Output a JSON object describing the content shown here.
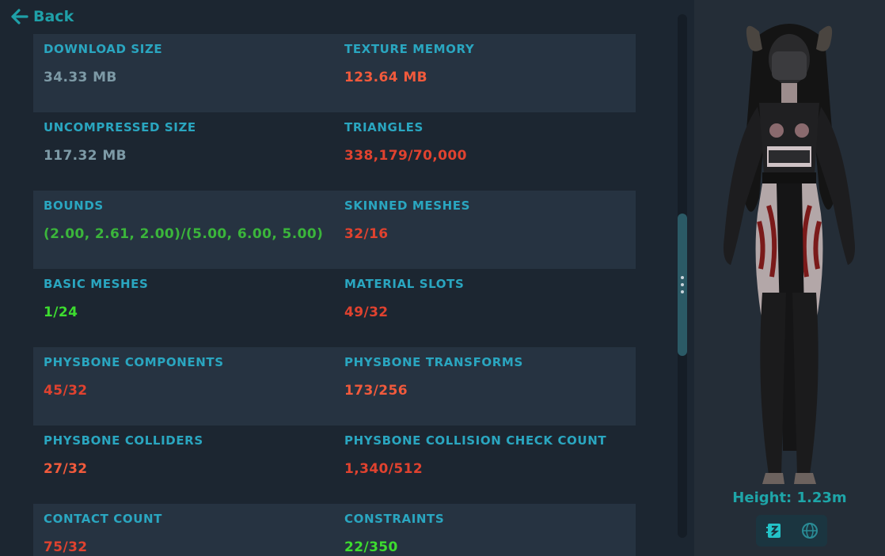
{
  "header": {
    "back_label": "Back"
  },
  "colors": {
    "label": "#2aa6c0",
    "neutral": "#7d9aa6",
    "red": "#e0422f",
    "salmon": "#f15a3c",
    "green_dark": "#3bb53b",
    "green_bright": "#3ddc2f",
    "accent": "#1fa0a8"
  },
  "stats": [
    [
      {
        "label": "DOWNLOAD SIZE",
        "value": "34.33 MB",
        "status": "neutral"
      },
      {
        "label": "TEXTURE MEMORY",
        "value": "123.64 MB",
        "status": "salmon"
      }
    ],
    [
      {
        "label": "UNCOMPRESSED SIZE",
        "value": "117.32 MB",
        "status": "neutral"
      },
      {
        "label": "TRIANGLES",
        "value": "338,179/70,000",
        "status": "red"
      }
    ],
    [
      {
        "label": "BOUNDS",
        "value": "(2.00, 2.61, 2.00)/(5.00, 6.00, 5.00)",
        "status": "green_dark"
      },
      {
        "label": "SKINNED MESHES",
        "value": "32/16",
        "status": "red"
      }
    ],
    [
      {
        "label": "BASIC MESHES",
        "value": "1/24",
        "status": "green_bright"
      },
      {
        "label": "MATERIAL SLOTS",
        "value": "49/32",
        "status": "red"
      }
    ],
    [
      {
        "label": "PHYSBONE COMPONENTS",
        "value": "45/32",
        "status": "red"
      },
      {
        "label": "PHYSBONE TRANSFORMS",
        "value": "173/256",
        "status": "salmon"
      }
    ],
    [
      {
        "label": "PHYSBONE COLLIDERS",
        "value": "27/32",
        "status": "salmon"
      },
      {
        "label": "PHYSBONE COLLISION CHECK COUNT",
        "value": "1,340/512",
        "status": "red"
      }
    ],
    [
      {
        "label": "CONTACT COUNT",
        "value": "75/32",
        "status": "red"
      },
      {
        "label": "CONSTRAINTS",
        "value": "22/350",
        "status": "green_bright"
      }
    ]
  ],
  "preview": {
    "height_label": "Height: 1.23m",
    "view_buttons": [
      {
        "icon": "avatar-card-icon",
        "active": true
      },
      {
        "icon": "globe-icon",
        "active": false
      }
    ]
  }
}
